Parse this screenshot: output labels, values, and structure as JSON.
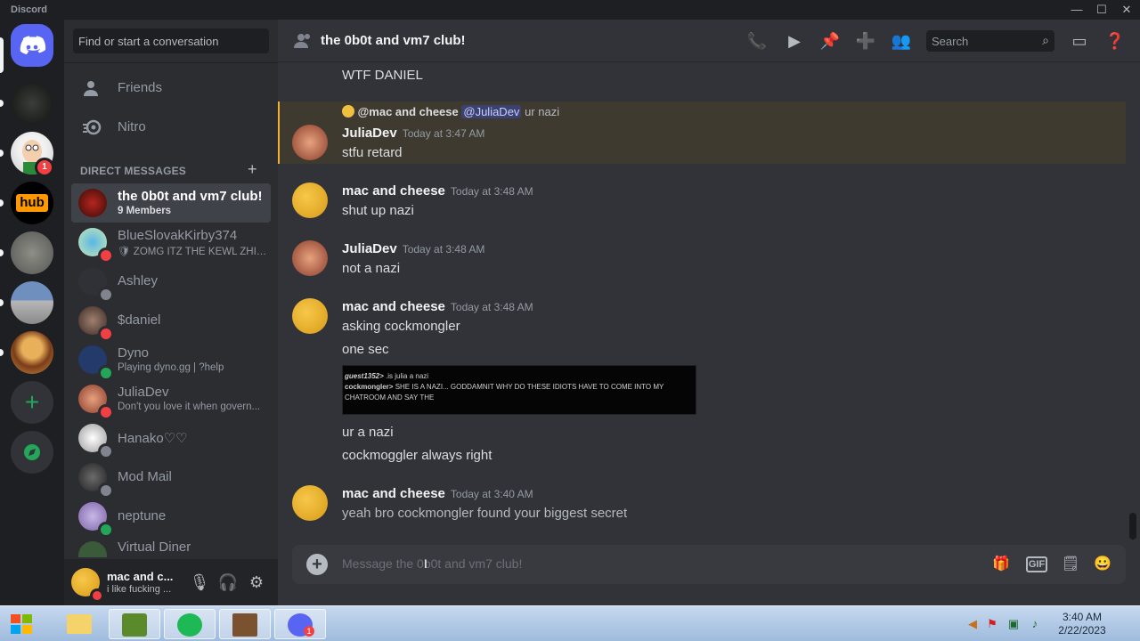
{
  "window": {
    "title": "Discord",
    "min": "—",
    "max": "☐",
    "close": "✕"
  },
  "servers": [
    {
      "name": "Direct Messages"
    },
    {
      "name": "server-dark"
    },
    {
      "name": "server-peter",
      "badge": "1"
    },
    {
      "name": "server-hub",
      "text": "hub"
    },
    {
      "name": "server-rocks"
    },
    {
      "name": "server-building"
    },
    {
      "name": "server-burger"
    }
  ],
  "sidebar": {
    "search_placeholder": "Find or start a conversation",
    "friends": "Friends",
    "nitro": "Nitro",
    "dm_header": "DIRECT MESSAGES",
    "dm_add": "+",
    "dms": [
      {
        "name": "the 0b0t and vm7 club!",
        "sub": "9 Members",
        "status": ""
      },
      {
        "name": "BlueSlovakKirby374",
        "sub": "🛡 ZOMG ITZ THE KEWL ZHIE...",
        "status": "dnd"
      },
      {
        "name": "Ashley",
        "sub": "",
        "status": "offline"
      },
      {
        "name": "$daniel",
        "sub": "",
        "status": "dnd"
      },
      {
        "name": "Dyno",
        "sub": "Playing dyno.gg | ?help",
        "status": "online"
      },
      {
        "name": "JuliaDev",
        "sub": "Don't you love it when govern...",
        "status": "dnd"
      },
      {
        "name": "Hanako♡♡",
        "sub": "",
        "status": "offline"
      },
      {
        "name": "Mod Mail",
        "sub": "",
        "status": "offline"
      },
      {
        "name": "neptune",
        "sub": "",
        "status": "online"
      },
      {
        "name": "Virtual Diner",
        "sub": "",
        "status": ""
      }
    ],
    "user": {
      "name": "mac and c...",
      "status": "i like fucking ..."
    }
  },
  "header": {
    "title": "the 0b0t and vm7 club!",
    "search_placeholder": "Search"
  },
  "messages": [
    {
      "text": "WTF DANIEL"
    },
    {
      "reply_author": "@mac and cheese",
      "reply_mention": "@JuliaDev",
      "reply_text": "ur nazi",
      "author": "JuliaDev",
      "time": "Today at 3:47 AM",
      "lines": [
        "stfu retard"
      ]
    },
    {
      "author": "mac and cheese",
      "time": "Today at 3:48 AM",
      "lines": [
        "shut up nazi"
      ]
    },
    {
      "author": "JuliaDev",
      "time": "Today at 3:48 AM",
      "lines": [
        "not a nazi"
      ]
    },
    {
      "author": "mac and cheese",
      "time": "Today at 3:48 AM",
      "lines": [
        "asking cockmongler",
        "one sec",
        "ur a nazi",
        "cockmoggler always right"
      ]
    },
    {
      "author": "mac and cheese",
      "time": "Today at 3:40 AM",
      "lines": [
        "yeah bro cockmongler found your biggest secret"
      ]
    }
  ],
  "embed": {
    "line1_name": "guest1352>",
    "line1_text": " .is julia a nazi",
    "line2_name": "cockmongler>",
    "line2_text": " SHE IS A NAZI... GODDAMNIT WHY DO THESE IDIOTS HAVE TO COME INTO MY CHATROOM AND SAY THE"
  },
  "composer": {
    "placeholder": "Message the 0b0t and vm7 club!",
    "gif": "GIF"
  },
  "taskbar": {
    "time": "3:40 AM",
    "date": "2/22/2023",
    "discord_badge": "1"
  }
}
